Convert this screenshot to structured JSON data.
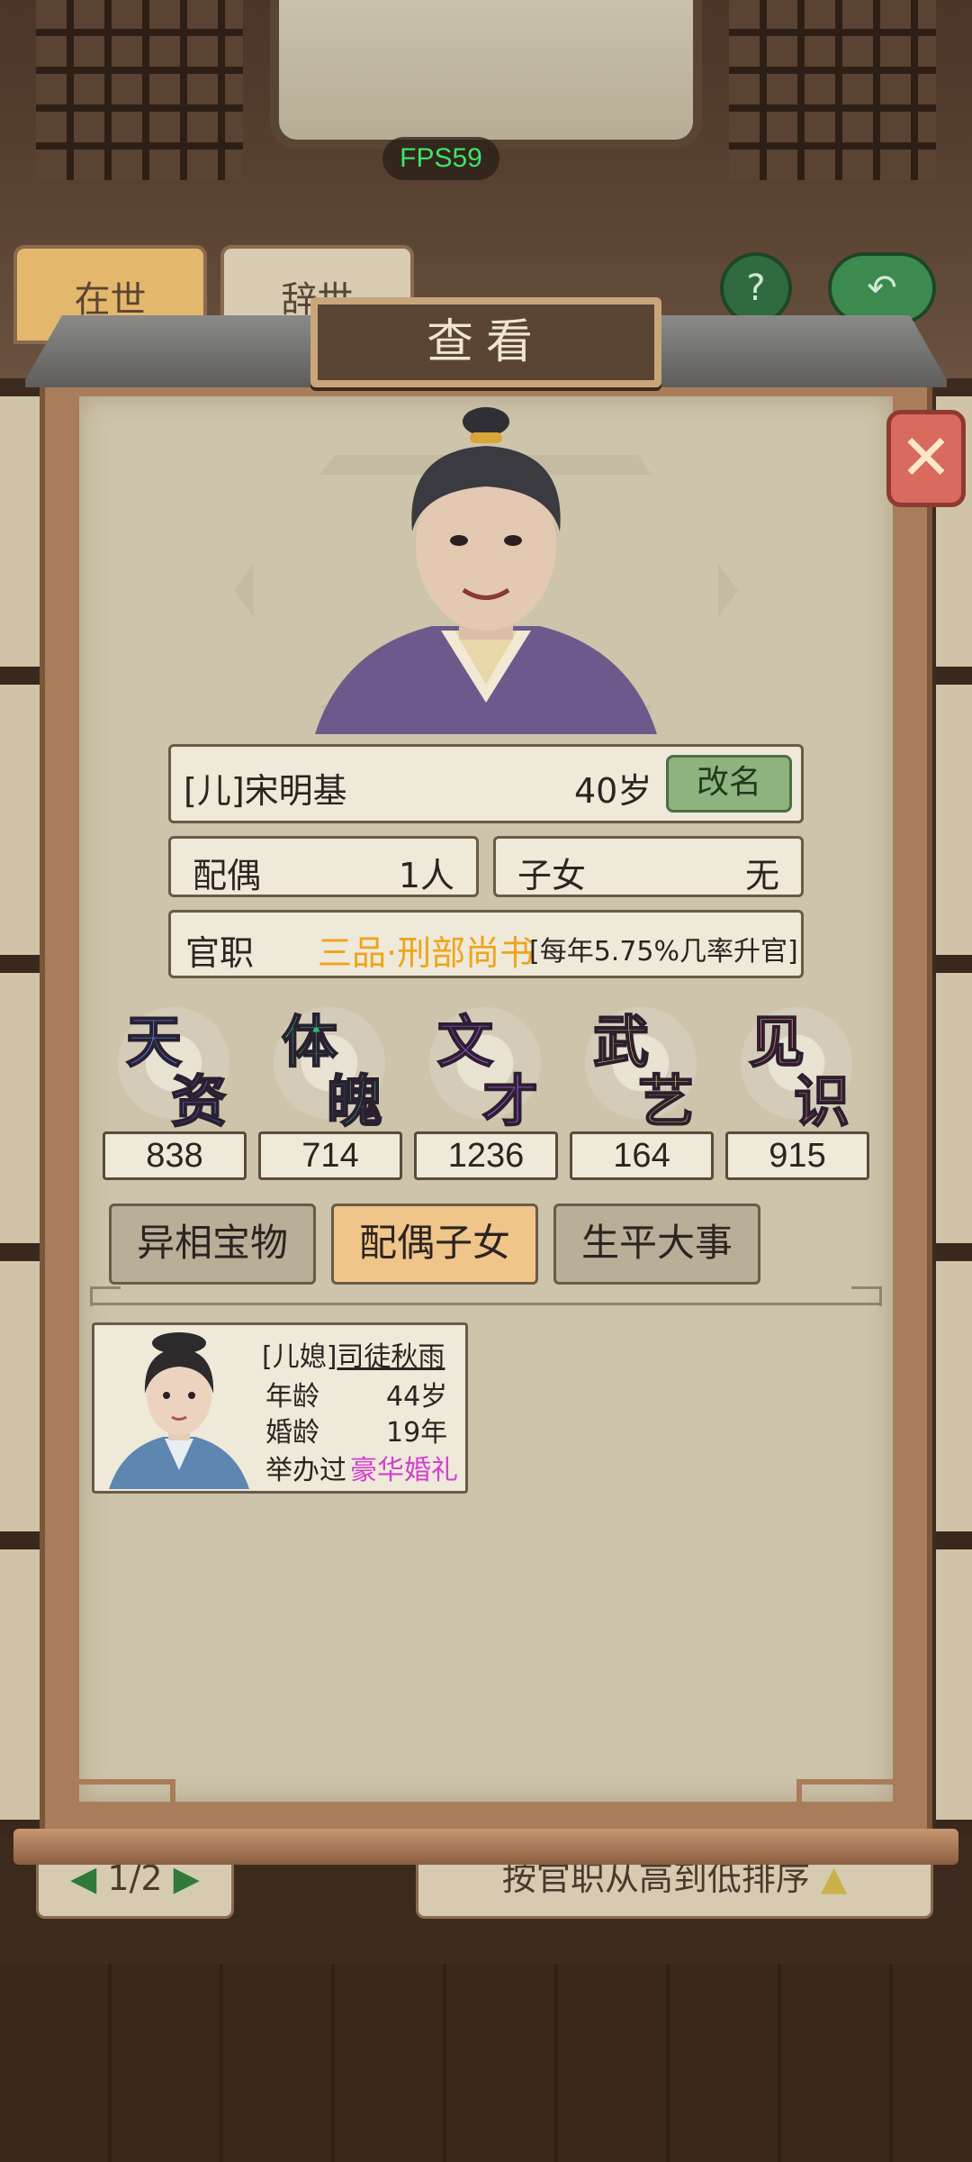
{
  "overlay": {
    "fps": "FPS59"
  },
  "background": {
    "tabs": [
      "在世",
      "辞世"
    ],
    "help_icon": "question-icon",
    "back_icon": "return-icon",
    "pager": "1/2",
    "sort_label": "按官职从高到低排序"
  },
  "dialog": {
    "title": "查看",
    "close_icon": "close-icon"
  },
  "character": {
    "name": "[儿]宋明基",
    "age": "40岁",
    "rename_label": "改名",
    "spouse_label": "配偶",
    "spouse_value": "1人",
    "children_label": "子女",
    "children_value": "无",
    "office_label": "官职",
    "office_value": "三品·刑部尚书",
    "office_note": "[每年5.75%几率升官]"
  },
  "stats": [
    {
      "c1": "天",
      "c2": "资",
      "value": "838",
      "color": "#4a7fe0"
    },
    {
      "c1": "体",
      "c2": "魄",
      "value": "714",
      "color": "#2fb86a"
    },
    {
      "c1": "文",
      "c2": "才",
      "value": "1236",
      "color": "#b04ad8"
    },
    {
      "c1": "武",
      "c2": "艺",
      "value": "164",
      "color": "#e8b64a"
    },
    {
      "c1": "见",
      "c2": "识",
      "value": "915",
      "color": "#e46a6a"
    }
  ],
  "tabs": [
    {
      "label": "异相宝物",
      "active": false
    },
    {
      "label": "配偶子女",
      "active": true
    },
    {
      "label": "生平大事",
      "active": false
    }
  ],
  "spouse_card": {
    "relation": "[儿媳]",
    "name": "司徒秋雨",
    "age_label": "年龄",
    "age_value": "44岁",
    "marriage_label": "婚龄",
    "marriage_value": "19年",
    "wedding_prefix": "举办过",
    "wedding_type": "豪华婚礼"
  }
}
